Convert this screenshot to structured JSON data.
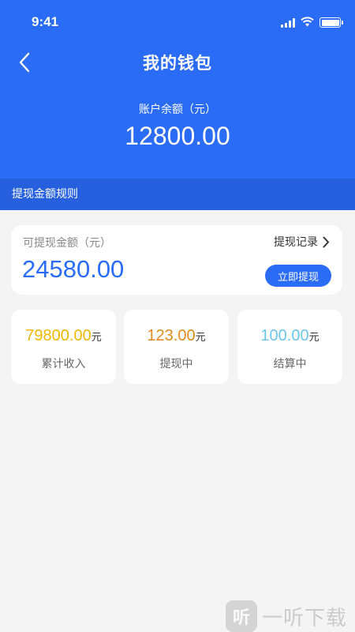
{
  "status_bar": {
    "time": "9:41"
  },
  "header": {
    "title": "我的钱包",
    "balance_label": "账户余额（元）",
    "balance_value": "12800.00",
    "background_color": "#2b6cf6"
  },
  "rules_bar": {
    "label": "提现金额规则"
  },
  "withdraw_card": {
    "label": "可提现金额（元）",
    "value": "24580.00",
    "records_label": "提现记录",
    "withdraw_button_label": "立即提现"
  },
  "stats": [
    {
      "value": "79800.00",
      "unit": "元",
      "label": "累计收入",
      "color": "#f2b705"
    },
    {
      "value": "123.00",
      "unit": "元",
      "label": "提现中",
      "color": "#e08a1e"
    },
    {
      "value": "100.00",
      "unit": "元",
      "label": "结算中",
      "color": "#6ac6ee"
    }
  ],
  "watermark": {
    "logo_glyph": "听",
    "text": "一听下载"
  }
}
